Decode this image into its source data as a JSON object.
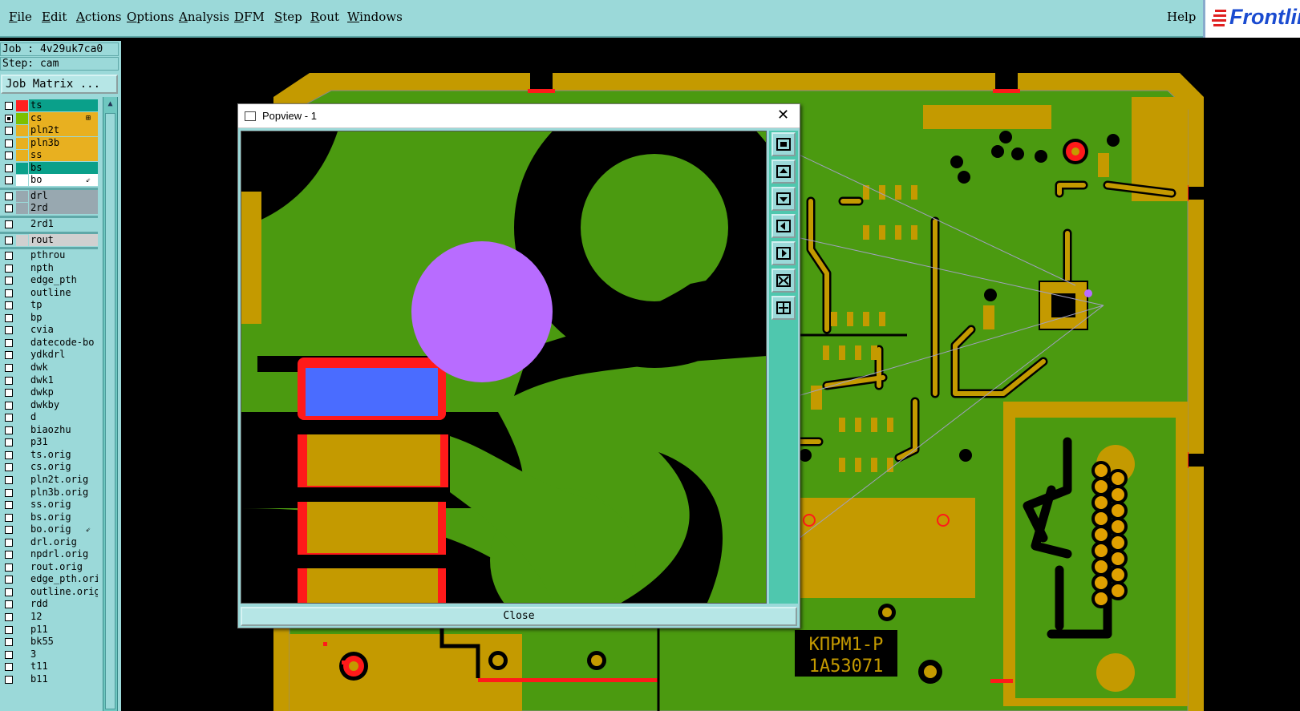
{
  "menubar": {
    "items": [
      {
        "label": "File"
      },
      {
        "label": "Edit"
      },
      {
        "label": "Actions"
      },
      {
        "label": "Options"
      },
      {
        "label": "Analysis"
      },
      {
        "label": "DFM"
      },
      {
        "label": "Step"
      },
      {
        "label": "Rout"
      },
      {
        "label": "Windows"
      }
    ],
    "help": "Help",
    "brand": "Frontline"
  },
  "job": {
    "label": "Job : 4v29uk7ca0",
    "step": "Step: cam",
    "matrix_button": "Job Matrix ..."
  },
  "layers": [
    {
      "name": "ts",
      "color": "#0aa08a",
      "swatch": "#ff2020",
      "checked": false
    },
    {
      "name": "cs",
      "color": "#e8b020",
      "swatch": "#7dc000",
      "checked": true,
      "mark": "⊞"
    },
    {
      "name": "pln2t",
      "color": "#e8b020",
      "swatch": "",
      "checked": false
    },
    {
      "name": "pln3b",
      "color": "#e8b020",
      "swatch": "",
      "checked": false
    },
    {
      "name": "ss",
      "color": "#e8b020",
      "swatch": "",
      "checked": false
    },
    {
      "name": "bs",
      "color": "#0aa08a",
      "swatch": "",
      "checked": false
    },
    {
      "name": "bo",
      "color": "#ffffff",
      "swatch": "",
      "checked": false,
      "mark": "⇙"
    },
    {
      "name": "drl",
      "color": "#98a8b0",
      "swatch": "",
      "checked": false
    },
    {
      "name": "2rd",
      "color": "#98a8b0",
      "swatch": "",
      "checked": false
    },
    {
      "name": "2rd1",
      "color": "#9bd9d9",
      "swatch": "",
      "checked": false
    },
    {
      "name": "rout",
      "color": "#d0d0d0",
      "swatch": "",
      "checked": false
    },
    {
      "name": "pthrou",
      "color": "#9bd9d9",
      "swatch": "",
      "checked": false
    },
    {
      "name": "npth",
      "color": "#9bd9d9",
      "swatch": "",
      "checked": false
    },
    {
      "name": "edge_pth",
      "color": "#9bd9d9",
      "swatch": "",
      "checked": false
    },
    {
      "name": "outline",
      "color": "#9bd9d9",
      "swatch": "",
      "checked": false
    },
    {
      "name": "tp",
      "color": "#9bd9d9",
      "swatch": "",
      "checked": false
    },
    {
      "name": "bp",
      "color": "#9bd9d9",
      "swatch": "",
      "checked": false
    },
    {
      "name": "cvia",
      "color": "#9bd9d9",
      "swatch": "",
      "checked": false
    },
    {
      "name": "datecode-bo",
      "color": "#9bd9d9",
      "swatch": "",
      "checked": false
    },
    {
      "name": "ydkdrl",
      "color": "#9bd9d9",
      "swatch": "",
      "checked": false
    },
    {
      "name": "dwk",
      "color": "#9bd9d9",
      "swatch": "",
      "checked": false
    },
    {
      "name": "dwk1",
      "color": "#9bd9d9",
      "swatch": "",
      "checked": false
    },
    {
      "name": "dwkp",
      "color": "#9bd9d9",
      "swatch": "",
      "checked": false
    },
    {
      "name": "dwkby",
      "color": "#9bd9d9",
      "swatch": "",
      "checked": false
    },
    {
      "name": "d",
      "color": "#9bd9d9",
      "swatch": "",
      "checked": false
    },
    {
      "name": "biaozhu",
      "color": "#9bd9d9",
      "swatch": "",
      "checked": false
    },
    {
      "name": "p31",
      "color": "#9bd9d9",
      "swatch": "",
      "checked": false
    },
    {
      "name": "ts.orig",
      "color": "#9bd9d9",
      "swatch": "",
      "checked": false
    },
    {
      "name": "cs.orig",
      "color": "#9bd9d9",
      "swatch": "",
      "checked": false
    },
    {
      "name": "pln2t.orig",
      "color": "#9bd9d9",
      "swatch": "",
      "checked": false
    },
    {
      "name": "pln3b.orig",
      "color": "#9bd9d9",
      "swatch": "",
      "checked": false
    },
    {
      "name": "ss.orig",
      "color": "#9bd9d9",
      "swatch": "",
      "checked": false
    },
    {
      "name": "bs.orig",
      "color": "#9bd9d9",
      "swatch": "",
      "checked": false
    },
    {
      "name": "bo.orig",
      "color": "#9bd9d9",
      "swatch": "",
      "checked": false,
      "mark": "⇙"
    },
    {
      "name": "drl.orig",
      "color": "#9bd9d9",
      "swatch": "",
      "checked": false
    },
    {
      "name": "npdrl.orig",
      "color": "#9bd9d9",
      "swatch": "",
      "checked": false
    },
    {
      "name": "rout.orig",
      "color": "#9bd9d9",
      "swatch": "",
      "checked": false
    },
    {
      "name": "edge_pth.ori",
      "color": "#9bd9d9",
      "swatch": "",
      "checked": false
    },
    {
      "name": "outline.orig",
      "color": "#9bd9d9",
      "swatch": "",
      "checked": false
    },
    {
      "name": "rdd",
      "color": "#9bd9d9",
      "swatch": "",
      "checked": false
    },
    {
      "name": "12",
      "color": "#9bd9d9",
      "swatch": "",
      "checked": false
    },
    {
      "name": "p11",
      "color": "#9bd9d9",
      "swatch": "",
      "checked": false
    },
    {
      "name": "bk55",
      "color": "#9bd9d9",
      "swatch": "",
      "checked": false
    },
    {
      "name": "3",
      "color": "#9bd9d9",
      "swatch": "",
      "checked": false
    },
    {
      "name": "t11",
      "color": "#9bd9d9",
      "swatch": "",
      "checked": false
    },
    {
      "name": "b11",
      "color": "#9bd9d9",
      "swatch": "",
      "checked": false
    }
  ],
  "popview": {
    "title": "Popview - 1",
    "close_glyph": "✕",
    "close_button": "Close",
    "tools": [
      "zoom-home-icon",
      "pan-up-icon",
      "pan-down-icon",
      "pan-left-icon",
      "pan-right-icon",
      "zoom-out-icon",
      "zoom-in-icon"
    ]
  },
  "board": {
    "silkscreen_line1": "КПРМ1-Р",
    "silkscreen_line2": "1A53071"
  },
  "colors": {
    "ui_teal": "#9bd9d9",
    "copper_green": "#4b9a10",
    "pad_gold": "#c49a00",
    "mask_red": "#ff1a1a",
    "highlight_purple": "#b86cff",
    "highlight_blue": "#4a6cff"
  }
}
